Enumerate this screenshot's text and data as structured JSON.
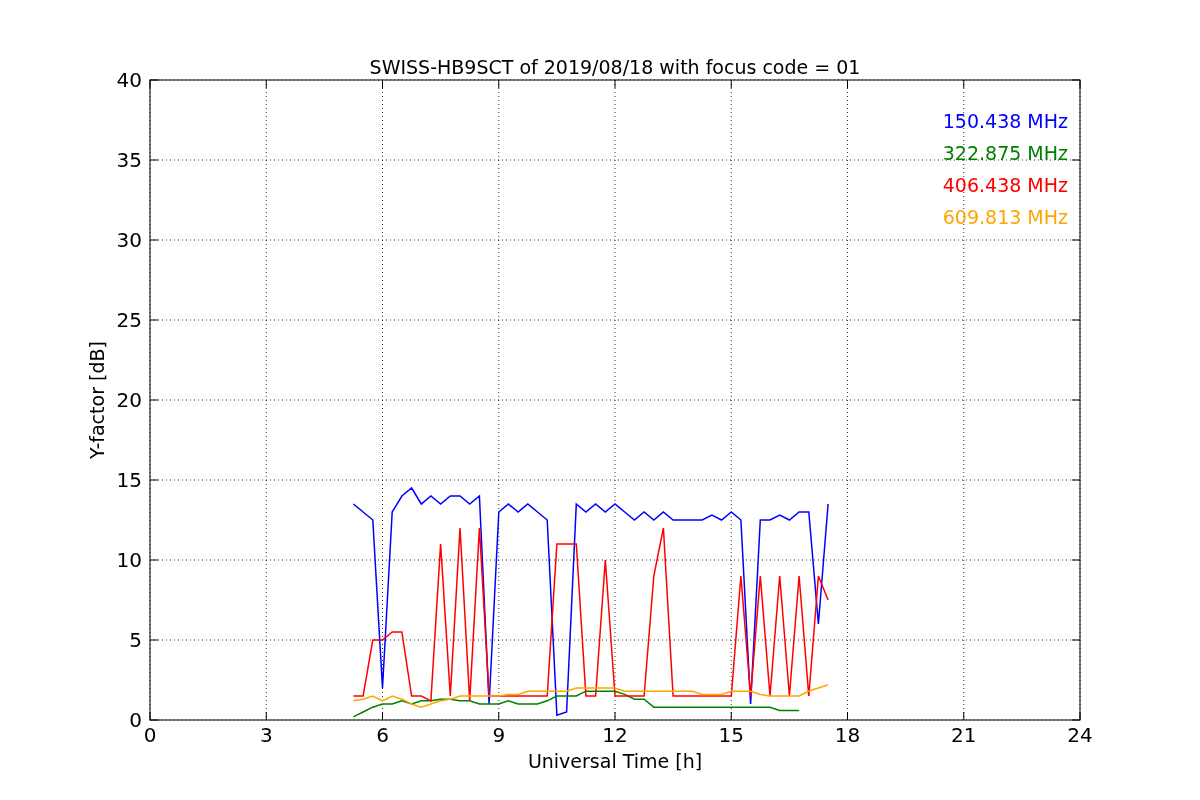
{
  "figure": {
    "chart_data": {
      "type": "line",
      "title": "SWISS-HB9SCT of 2019/08/18 with focus code = 01",
      "xlabel": "Universal Time [h]",
      "ylabel": "Y-factor [dB]",
      "grid": true,
      "xlim": [
        0,
        24
      ],
      "ylim": [
        0,
        40
      ],
      "xticks": [
        0,
        3,
        6,
        9,
        12,
        15,
        18,
        21,
        24
      ],
      "yticks": [
        0,
        5,
        10,
        15,
        20,
        25,
        30,
        35,
        40
      ],
      "x": [
        5.25,
        5.5,
        5.75,
        6,
        6.25,
        6.5,
        6.75,
        7,
        7.25,
        7.5,
        7.75,
        8,
        8.25,
        8.5,
        8.75,
        9,
        9.25,
        9.5,
        9.75,
        10,
        10.25,
        10.5,
        10.75,
        11,
        11.25,
        11.5,
        11.75,
        12,
        12.25,
        12.5,
        12.75,
        13,
        13.25,
        13.5,
        13.75,
        14,
        14.25,
        14.5,
        14.75,
        15,
        15.25,
        15.5,
        15.75,
        16,
        16.25,
        16.5,
        16.75,
        17,
        17.25,
        17.5
      ],
      "series": [
        {
          "name": "150.438 MHz",
          "color": "#0000ff",
          "values": [
            13.5,
            13,
            12.5,
            2,
            13,
            14,
            14.5,
            13.5,
            14,
            13.5,
            14,
            14,
            13.5,
            14,
            1,
            13,
            13.5,
            13,
            13.5,
            13,
            12.5,
            0.3,
            0.5,
            13.5,
            13,
            13.5,
            13,
            13.5,
            13,
            12.5,
            13,
            12.5,
            13,
            12.5,
            12.5,
            12.5,
            12.5,
            12.8,
            12.5,
            13,
            12.5,
            1,
            12.5,
            12.5,
            12.8,
            12.5,
            13,
            13,
            6,
            13.5
          ]
        },
        {
          "name": "322.875 MHz",
          "color": "#008000",
          "values": [
            0.2,
            0.5,
            0.8,
            1,
            1,
            1.2,
            1,
            1.2,
            1.2,
            1.3,
            1.3,
            1.2,
            1.2,
            1,
            1,
            1,
            1.2,
            1,
            1,
            1,
            1.2,
            1.5,
            1.5,
            1.5,
            1.8,
            1.8,
            1.8,
            1.8,
            1.6,
            1.3,
            1.3,
            0.8,
            0.8,
            0.8,
            0.8,
            0.8,
            0.8,
            0.8,
            0.8,
            0.8,
            0.8,
            0.8,
            0.8,
            0.8,
            0.6,
            0.6,
            0.6,
            null,
            null,
            null
          ]
        },
        {
          "name": "406.438 MHz",
          "color": "#ff0000",
          "values": [
            1.5,
            1.5,
            5,
            5,
            5.5,
            5.5,
            1.5,
            1.5,
            1.2,
            11,
            1.5,
            12,
            1.2,
            12,
            1.5,
            1.5,
            1.5,
            1.5,
            1.5,
            1.5,
            1.5,
            11,
            11,
            11,
            1.5,
            1.5,
            10,
            1.5,
            1.5,
            1.5,
            1.5,
            9,
            12,
            1.5,
            1.5,
            1.5,
            1.5,
            1.5,
            1.5,
            1.5,
            9,
            1.5,
            9,
            1.5,
            9,
            1.5,
            9,
            1.5,
            9,
            7.5
          ]
        },
        {
          "name": "609.813 MHz",
          "color": "#ffa500",
          "values": [
            1.2,
            1.3,
            1.5,
            1.2,
            1.5,
            1.3,
            1,
            0.8,
            1,
            1.2,
            1.3,
            1.5,
            1.5,
            1.5,
            1.5,
            1.5,
            1.6,
            1.6,
            1.8,
            1.8,
            1.8,
            1.8,
            1.8,
            2,
            2,
            2,
            2,
            2,
            1.8,
            1.8,
            1.8,
            1.8,
            1.8,
            1.8,
            1.8,
            1.8,
            1.6,
            1.6,
            1.6,
            1.8,
            1.8,
            1.8,
            1.6,
            1.5,
            1.5,
            1.5,
            1.5,
            1.8,
            2,
            2.2
          ]
        }
      ]
    }
  }
}
